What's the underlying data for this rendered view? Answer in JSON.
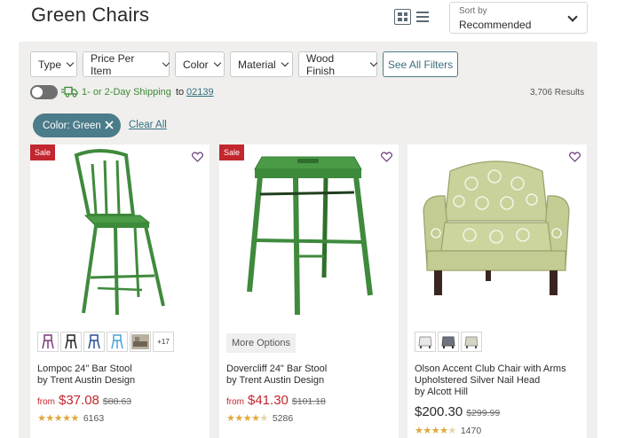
{
  "page": {
    "title": "Green Chairs"
  },
  "view": {
    "grid_icon": "grid-view-icon",
    "list_icon": "list-view-icon"
  },
  "sort": {
    "label": "Sort by",
    "value": "Recommended"
  },
  "filters": [
    {
      "label": "Type"
    },
    {
      "label": "Price Per Item"
    },
    {
      "label": "Color"
    },
    {
      "label": "Material"
    },
    {
      "label": "Wood Finish"
    }
  ],
  "see_all_filters": "See All Filters",
  "shipping": {
    "text": "1- or 2-Day Shipping",
    "to": "to",
    "zip": "02139",
    "toggle_on": false
  },
  "results": "3,706 Results",
  "active_filter": {
    "label": "Color: Green"
  },
  "clear_all": "Clear All",
  "colors": {
    "accent": "#4b7c8a",
    "sale": "#c2262e",
    "green_text": "#3d8a34",
    "star": "#e0a93b"
  },
  "products": [
    {
      "badge": "Sale",
      "name": "Lompoc 24\" Bar Stool",
      "by": "by Trent Austin Design",
      "from": "from",
      "price": "$37.08",
      "old_price": "$88.63",
      "rating": 4.5,
      "reviews": "6163",
      "swatches_more": "+17"
    },
    {
      "badge": "Sale",
      "name": "Dovercliff 24\" Bar Stool",
      "by": "by Trent Austin Design",
      "more_options": "More Options",
      "from": "from",
      "price": "$41.30",
      "old_price": "$101.18",
      "rating": 4.5,
      "reviews": "5286"
    },
    {
      "name": "Olson Accent Club Chair with Arms Upholstered Silver Nail Head",
      "by": "by Alcott Hill",
      "price": "$200.30",
      "old_price": "$299.99",
      "rating": 4.5,
      "reviews": "1470"
    }
  ]
}
